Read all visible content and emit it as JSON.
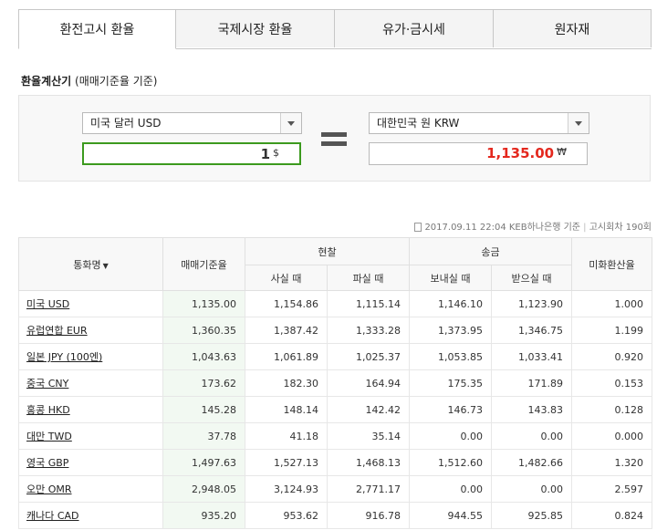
{
  "tabs": [
    {
      "label": "환전고시 환율"
    },
    {
      "label": "국제시장 환율"
    },
    {
      "label": "유가·금시세"
    },
    {
      "label": "원자재"
    }
  ],
  "calculator": {
    "title": "환율계산기",
    "subtitle": "(매매기준율 기준)",
    "from_currency": "미국 달러 USD",
    "from_amount": "1",
    "from_unit": "$",
    "to_currency": "대한민국 원 KRW",
    "to_amount": "1,135.00",
    "to_unit": "₩",
    "amount_color": "#e4281e",
    "input_border_color": "#3c9a1e"
  },
  "meta": {
    "text": "2017.09.11 22:04 KEB하나은행 기준",
    "round": "고시회차 190회"
  },
  "table": {
    "headers": {
      "currency": "통화명",
      "base_rate": "매매기준율",
      "cash": "현찰",
      "cash_buy": "사실 때",
      "cash_sell": "파실 때",
      "transfer": "송금",
      "send": "보내실 때",
      "receive": "받으실 때",
      "usd_rate": "미화환산율"
    },
    "rows": [
      {
        "name": "미국 USD",
        "base": "1,135.00",
        "cash_buy": "1,154.86",
        "cash_sell": "1,115.14",
        "send": "1,146.10",
        "receive": "1,123.90",
        "usd": "1.000"
      },
      {
        "name": "유럽연합 EUR",
        "base": "1,360.35",
        "cash_buy": "1,387.42",
        "cash_sell": "1,333.28",
        "send": "1,373.95",
        "receive": "1,346.75",
        "usd": "1.199"
      },
      {
        "name": "일본 JPY (100엔)",
        "base": "1,043.63",
        "cash_buy": "1,061.89",
        "cash_sell": "1,025.37",
        "send": "1,053.85",
        "receive": "1,033.41",
        "usd": "0.920"
      },
      {
        "name": "중국 CNY",
        "base": "173.62",
        "cash_buy": "182.30",
        "cash_sell": "164.94",
        "send": "175.35",
        "receive": "171.89",
        "usd": "0.153"
      },
      {
        "name": "홍콩 HKD",
        "base": "145.28",
        "cash_buy": "148.14",
        "cash_sell": "142.42",
        "send": "146.73",
        "receive": "143.83",
        "usd": "0.128"
      },
      {
        "name": "대만 TWD",
        "base": "37.78",
        "cash_buy": "41.18",
        "cash_sell": "35.14",
        "send": "0.00",
        "receive": "0.00",
        "usd": "0.000"
      },
      {
        "name": "영국 GBP",
        "base": "1,497.63",
        "cash_buy": "1,527.13",
        "cash_sell": "1,468.13",
        "send": "1,512.60",
        "receive": "1,482.66",
        "usd": "1.320"
      },
      {
        "name": "오만 OMR",
        "base": "2,948.05",
        "cash_buy": "3,124.93",
        "cash_sell": "2,771.17",
        "send": "0.00",
        "receive": "0.00",
        "usd": "2.597"
      },
      {
        "name": "캐나다 CAD",
        "base": "935.20",
        "cash_buy": "953.62",
        "cash_sell": "916.78",
        "send": "944.55",
        "receive": "925.85",
        "usd": "0.824"
      }
    ]
  }
}
